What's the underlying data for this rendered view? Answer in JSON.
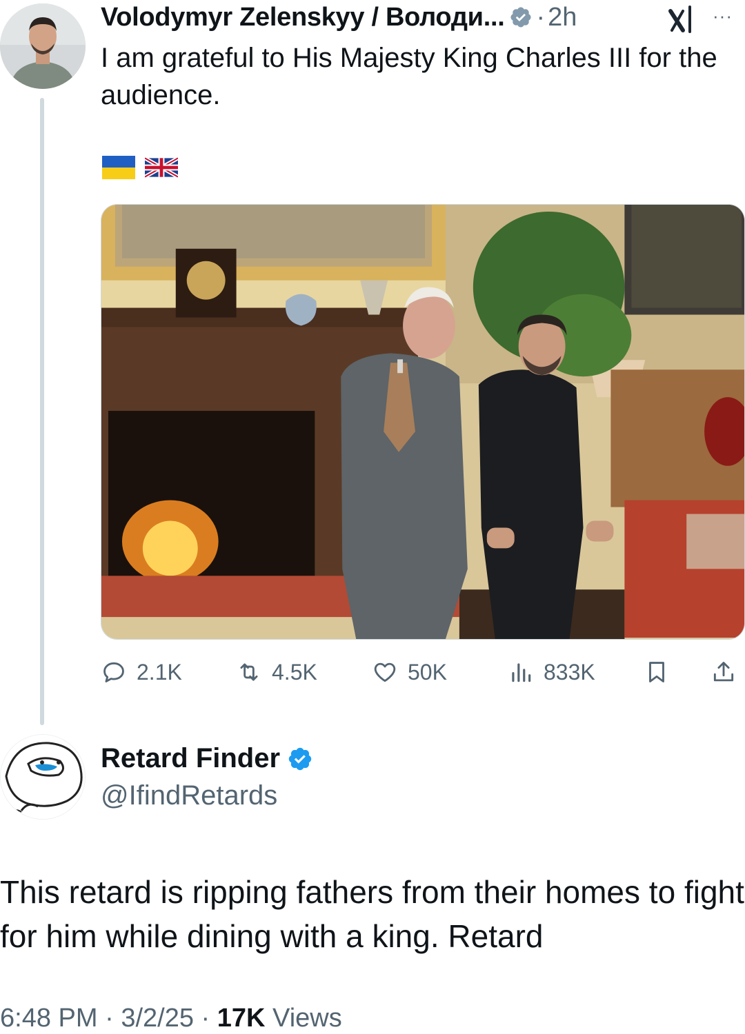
{
  "original_tweet": {
    "author_name": "Volodymyr Zelenskyy / Володи...",
    "separator": "·",
    "time": "2h",
    "more_label": "···",
    "text": "I am grateful to His Majesty King Charles III for the audience.",
    "flags": [
      "ukraine-flag-icon",
      "uk-flag-icon"
    ],
    "photo": "photo-king-charles-and-zelenskyy-by-fireplace",
    "actions": {
      "reply_count": "2.1K",
      "retweet_count": "4.5K",
      "like_count": "50K",
      "views_count": "833K"
    },
    "icons": {
      "verified": "verified-gray-icon",
      "grok": "grok-icon",
      "reply": "reply-icon",
      "retweet": "retweet-icon",
      "like": "heart-icon",
      "views": "views-icon",
      "bookmark": "bookmark-icon",
      "share": "share-icon"
    }
  },
  "reply_tweet": {
    "author_name": "Retard Finder",
    "handle": "@IfindRetards",
    "text": "This retard is ripping fathers from their homes to fight for him while dining with a king. Retard",
    "time": "6:48 PM",
    "date": "3/2/25",
    "separator": "·",
    "views_count": "17K",
    "views_label": "Views"
  },
  "colors": {
    "text_primary": "#0f1419",
    "text_secondary": "#536471",
    "verified_blue": "#1d9bf0",
    "verified_gray": "#829aab",
    "thread_line": "#cfd9de"
  }
}
